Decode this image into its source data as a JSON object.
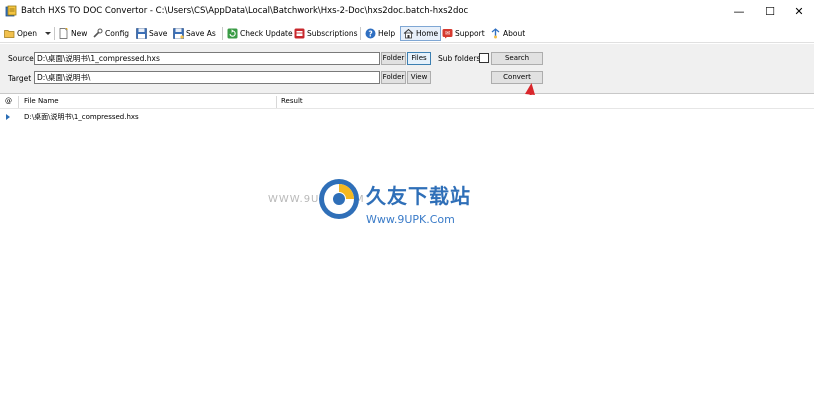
{
  "window": {
    "title": "Batch HXS TO DOC Convertor - C:\\Users\\CS\\AppData\\Local\\Batchwork\\Hxs-2-Doc\\hxs2doc.batch-hxs2doc",
    "minimize": "—",
    "maximize": "☐",
    "close": "✕"
  },
  "toolbar": {
    "open": "Open",
    "new": "New",
    "config": "Config",
    "save": "Save",
    "save_as": "Save As",
    "check_update": "Check Update",
    "subscriptions": "Subscriptions",
    "help": "Help",
    "home": "Home",
    "support": "Support",
    "about": "About"
  },
  "panel": {
    "source_label": "Source",
    "source_value": "D:\\桌面\\说明书\\1_compressed.hxs",
    "target_label": "Target",
    "target_value": "D:\\桌面\\说明书\\",
    "folder_btn": "Folder",
    "files_btn": "Files",
    "sub_folders_label": "Sub folders",
    "search_btn": "Search",
    "target_folder_btn": "Folder",
    "view_btn": "View",
    "convert_btn": "Convert"
  },
  "grid": {
    "col_at": "@",
    "col_file_name": "File Name",
    "col_result": "Result",
    "rows": [
      {
        "file_name": "D:\\桌面\\说明书\\1_compressed.hxs",
        "result": ""
      }
    ]
  },
  "watermark": {
    "small": "WWW.9UPK.COM",
    "big": "久友下载站",
    "url": "Www.9UPK.Com"
  },
  "colors": {
    "accent": "#2a6db5",
    "arrow": "#d9262b",
    "panel_bg": "#f0f0f0"
  }
}
